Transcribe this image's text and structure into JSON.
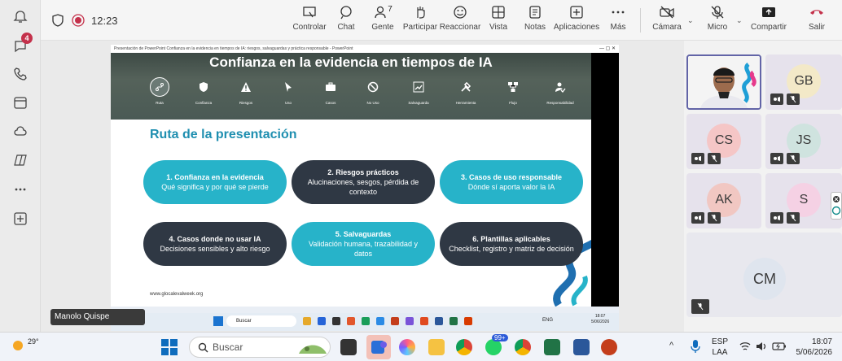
{
  "rail": {
    "chat_badge": "4"
  },
  "topbar": {
    "time": "12:23",
    "buttons": [
      "Controlar",
      "Chat",
      "Gente",
      "Participar",
      "Reaccionar",
      "Vista",
      "Notas",
      "Aplicaciones",
      "Más",
      "Cámara",
      "Micro",
      "Compartir",
      "Salir"
    ],
    "people_count": "7"
  },
  "ppt": {
    "titlebar": "Presentación de PowerPoint   Confianza en la evidencia en tiempos de IA: riesgos, salvaguardas y práctica responsable - PowerPoint"
  },
  "slide": {
    "title": "Confianza en la evidencia en tiempos de IA",
    "nav": [
      "Ruta",
      "Confianza",
      "Riesgos",
      "Uso",
      "Casos",
      "No Uso",
      "Salvaguarda",
      "Herramienta",
      "Flujo",
      "Responsabilidad"
    ],
    "route_title": "Ruta de la presentación",
    "cards": [
      {
        "title": "1. Confianza en la evidencia",
        "desc": "Qué significa y por qué se pierde",
        "style": "teal"
      },
      {
        "title": "2. Riesgos prácticos",
        "desc": "Alucinaciones, sesgos, pérdida de contexto",
        "style": "dark"
      },
      {
        "title": "3. Casos de uso responsable",
        "desc": "Dónde sí aporta valor la IA",
        "style": "teal"
      },
      {
        "title": "4. Casos donde no usar IA",
        "desc": "Decisiones sensibles y alto riesgo",
        "style": "dark"
      },
      {
        "title": "5. Salvaguardas",
        "desc": "Validación humana, trazabilidad y datos",
        "style": "teal"
      },
      {
        "title": "6. Plantillas aplicables",
        "desc": "Checklist, registro y matriz de decisión",
        "style": "dark"
      }
    ],
    "url": "www.glocalevalweek.org"
  },
  "inner_taskbar": {
    "search": "Buscar",
    "lang": "ENG",
    "time": "18:07",
    "date": "5/06/2026"
  },
  "presenter": "Manolo Quispe",
  "participants": [
    {
      "initials": "GB"
    },
    {
      "initials": "CS"
    },
    {
      "initials": "JS"
    },
    {
      "initials": "AK"
    },
    {
      "initials": "S"
    },
    {
      "initials": "CM"
    }
  ],
  "taskbar": {
    "temp": "29°",
    "search": "Buscar",
    "whatsapp_badge": "99+",
    "lang1": "ESP",
    "lang2": "LAA",
    "time": "18:07",
    "date": "5/06/2026"
  }
}
